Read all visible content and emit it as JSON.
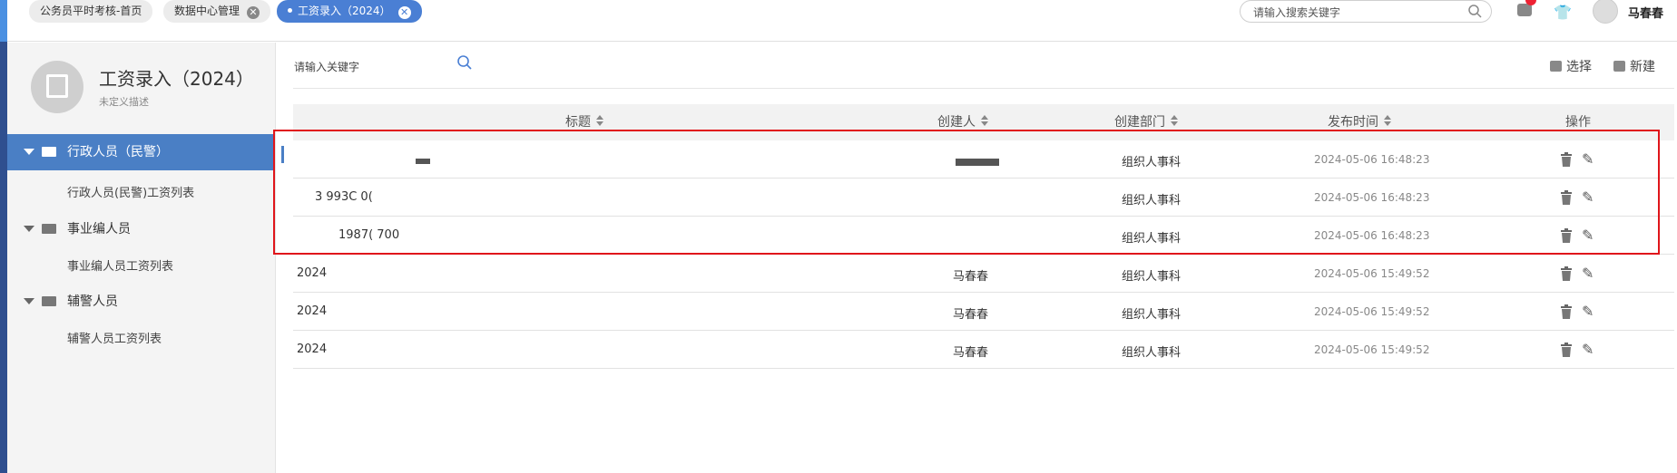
{
  "tabs": [
    {
      "label": "公务员平时考核-首页",
      "closable": false,
      "active": false
    },
    {
      "label": "数据中心管理",
      "closable": true,
      "active": false
    },
    {
      "label": "工资录入（2024）",
      "closable": true,
      "active": true
    }
  ],
  "header": {
    "search_placeholder": "请输入搜索关键字",
    "username": "马春春"
  },
  "app": {
    "title": "工资录入（2024）",
    "description": "未定义描述"
  },
  "sidebar": {
    "groups": [
      {
        "label": "行政人员（民警）",
        "active": true,
        "children": [
          "行政人员(民警)工资列表"
        ]
      },
      {
        "label": "事业编人员",
        "active": false,
        "children": [
          "事业编人员工资列表"
        ]
      },
      {
        "label": "辅警人员",
        "active": false,
        "children": [
          "辅警人员工资列表"
        ]
      }
    ]
  },
  "toolbar": {
    "search_placeholder": "请输入关键字",
    "select_label": "选择",
    "new_label": "新建"
  },
  "table": {
    "columns": [
      "标题",
      "创建人",
      "创建部门",
      "发布时间",
      "操作"
    ],
    "rows": [
      {
        "title": "",
        "creator": "",
        "department": "组织人事科",
        "time": "2024-05-06 16:48:23"
      },
      {
        "title": "3    993C    0(",
        "creator": "",
        "department": "组织人事科",
        "time": "2024-05-06 16:48:23"
      },
      {
        "title": "1987(    700",
        "creator": "",
        "department": "组织人事科",
        "time": "2024-05-06 16:48:23"
      },
      {
        "title": "2024",
        "creator": "马春春",
        "department": "组织人事科",
        "time": "2024-05-06 15:49:52"
      },
      {
        "title": "2024",
        "creator": "马春春",
        "department": "组织人事科",
        "time": "2024-05-06 15:49:52"
      },
      {
        "title": "2024",
        "creator": "马春春",
        "department": "组织人事科",
        "time": "2024-05-06 15:49:52"
      }
    ]
  },
  "colors": {
    "accent": "#4a7fc5",
    "highlight_border": "#e0151b"
  }
}
